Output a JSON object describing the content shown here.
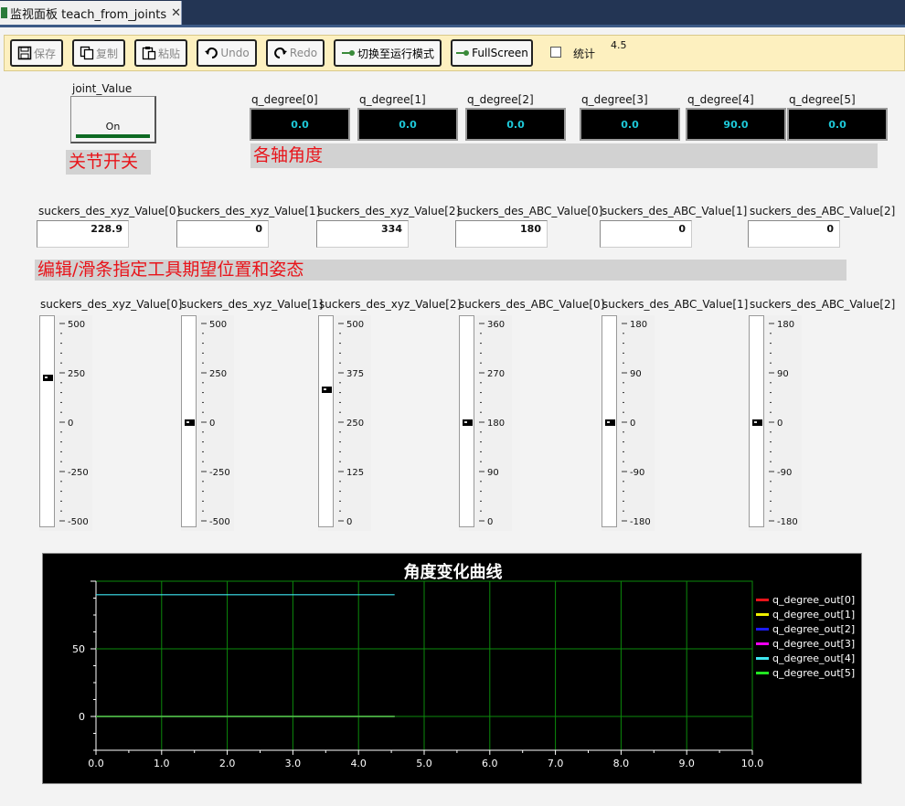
{
  "tab": {
    "title": "监视面板 teach_from_joints",
    "close": "✕"
  },
  "toolbar": {
    "buttons": [
      {
        "label": "保存",
        "icon": "save-icon"
      },
      {
        "label": "复制",
        "icon": "copy-icon"
      },
      {
        "label": "粘贴",
        "icon": "paste-icon"
      },
      {
        "label": "Undo",
        "icon": "undo-icon"
      },
      {
        "label": "Redo",
        "icon": "redo-icon"
      },
      {
        "label": "切换至运行模式",
        "icon": "switch-icon"
      },
      {
        "label": "FullScreen",
        "icon": "fullscreen-icon"
      }
    ],
    "stats_label": "统计",
    "stats_checked": false,
    "value_text": "4.5"
  },
  "joint_switch": {
    "title": "joint_Value",
    "state": "On",
    "caption": "关节开关"
  },
  "degrees": {
    "caption": "各轴角度",
    "items": [
      {
        "label": "q_degree[0]",
        "value": "0.0"
      },
      {
        "label": "q_degree[1]",
        "value": "0.0"
      },
      {
        "label": "q_degree[2]",
        "value": "0.0"
      },
      {
        "label": "q_degree[3]",
        "value": "0.0"
      },
      {
        "label": "q_degree[4]",
        "value": "90.0"
      },
      {
        "label": "q_degree[5]",
        "value": "0.0"
      }
    ]
  },
  "inputs": [
    {
      "label": "suckers_des_xyz_Value[0]",
      "value": "228.9"
    },
    {
      "label": "suckers_des_xyz_Value[1]",
      "value": "0"
    },
    {
      "label": "suckers_des_xyz_Value[2]",
      "value": "334"
    },
    {
      "label": "suckers_des_ABC_Value[0]",
      "value": "180"
    },
    {
      "label": "suckers_des_ABC_Value[1]",
      "value": "0"
    },
    {
      "label": "suckers_des_ABC_Value[2]",
      "value": "0"
    }
  ],
  "edit_caption": "编辑/滑条指定工具期望位置和姿态",
  "sliders": [
    {
      "label": "suckers_des_xyz_Value[0]",
      "ticks": [
        "500",
        "250",
        "0",
        "-250",
        "-500"
      ],
      "min": -500,
      "max": 500,
      "value": 228.9
    },
    {
      "label": "suckers_des_xyz_Value[1]",
      "ticks": [
        "500",
        "250",
        "0",
        "-250",
        "-500"
      ],
      "min": -500,
      "max": 500,
      "value": 0
    },
    {
      "label": "suckers_des_xyz_Value[2]",
      "ticks": [
        "500",
        "375",
        "250",
        "125",
        "0"
      ],
      "min": 0,
      "max": 500,
      "value": 334
    },
    {
      "label": "suckers_des_ABC_Value[0]",
      "ticks": [
        "360",
        "270",
        "180",
        "90",
        "0"
      ],
      "min": 0,
      "max": 360,
      "value": 180
    },
    {
      "label": "suckers_des_ABC_Value[1]",
      "ticks": [
        "180",
        "90",
        "0",
        "-90",
        "-180"
      ],
      "min": -180,
      "max": 180,
      "value": 0
    },
    {
      "label": "suckers_des_ABC_Value[2]",
      "ticks": [
        "180",
        "90",
        "0",
        "-90",
        "-180"
      ],
      "min": -180,
      "max": 180,
      "value": 0
    }
  ],
  "chart_data": {
    "type": "line",
    "title": "角度变化曲线",
    "xlabel": "",
    "ylabel": "",
    "xlim": [
      0,
      10
    ],
    "ylim": [
      -25,
      100
    ],
    "xticks": [
      "0.0",
      "1.0",
      "2.0",
      "3.0",
      "4.0",
      "5.0",
      "6.0",
      "7.0",
      "8.0",
      "9.0",
      "10.0"
    ],
    "yticks": [
      "0",
      "50"
    ],
    "grid": true,
    "legend_position": "right",
    "series": [
      {
        "name": "q_degree_out[0]",
        "color": "#e8141a",
        "x": [
          0,
          4.55
        ],
        "y": [
          0,
          0
        ]
      },
      {
        "name": "q_degree_out[1]",
        "color": "#f0f000",
        "x": [
          0,
          4.55
        ],
        "y": [
          0,
          0
        ]
      },
      {
        "name": "q_degree_out[2]",
        "color": "#1c1cf0",
        "x": [
          0,
          4.55
        ],
        "y": [
          0,
          0
        ]
      },
      {
        "name": "q_degree_out[3]",
        "color": "#f000f0",
        "x": [
          0,
          4.55
        ],
        "y": [
          0,
          0
        ]
      },
      {
        "name": "q_degree_out[4]",
        "color": "#3ee6f0",
        "x": [
          0,
          4.55
        ],
        "y": [
          90,
          90
        ]
      },
      {
        "name": "q_degree_out[5]",
        "color": "#22e622",
        "x": [
          0,
          4.55
        ],
        "y": [
          0,
          0
        ]
      }
    ]
  }
}
